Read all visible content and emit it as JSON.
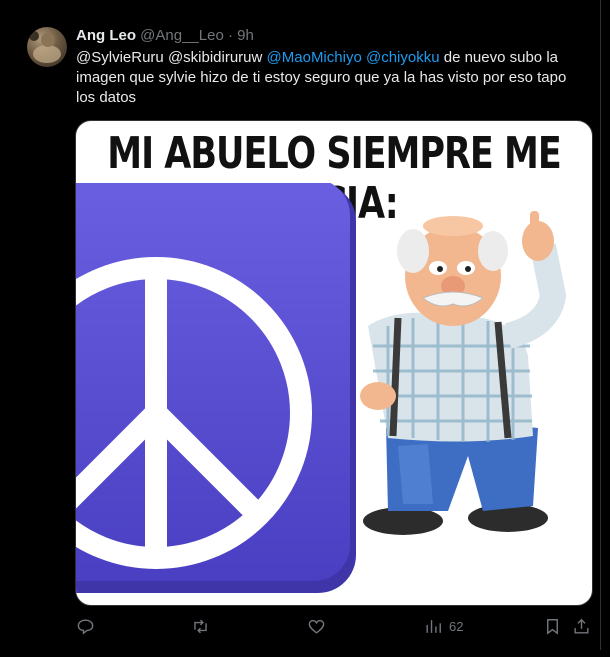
{
  "tweet": {
    "author_name": "Ang Leo",
    "handle": "@Ang__Leo",
    "separator": "·",
    "time": "9h",
    "text": {
      "mention_1": "@SylvieRuru",
      "mention_2": "@skibidiruruw",
      "link_mention_1": "@MaoMichiyo",
      "link_mention_2": "@chiyokku",
      "body": "de nuevo subo la imagen que sylvie hizo de ti estoy seguro que ya la has visto por eso tapo los datos"
    },
    "media": {
      "caption": "MI ABUELO SIEMPRE ME DECIA:",
      "peace_color": "#5b4fd1",
      "icon_left": "peace-symbol",
      "icon_right": "grandpa-pointing-up"
    },
    "actions": {
      "reply_icon": "reply-icon",
      "retweet_icon": "retweet-icon",
      "like_icon": "heart-icon",
      "views_icon": "views-icon",
      "views_count": "62",
      "bookmark_icon": "bookmark-icon",
      "share_icon": "share-icon"
    }
  },
  "colors": {
    "background": "#000000",
    "text_primary": "#e7e9ea",
    "text_secondary": "#71767b",
    "link": "#1d9bf0"
  }
}
